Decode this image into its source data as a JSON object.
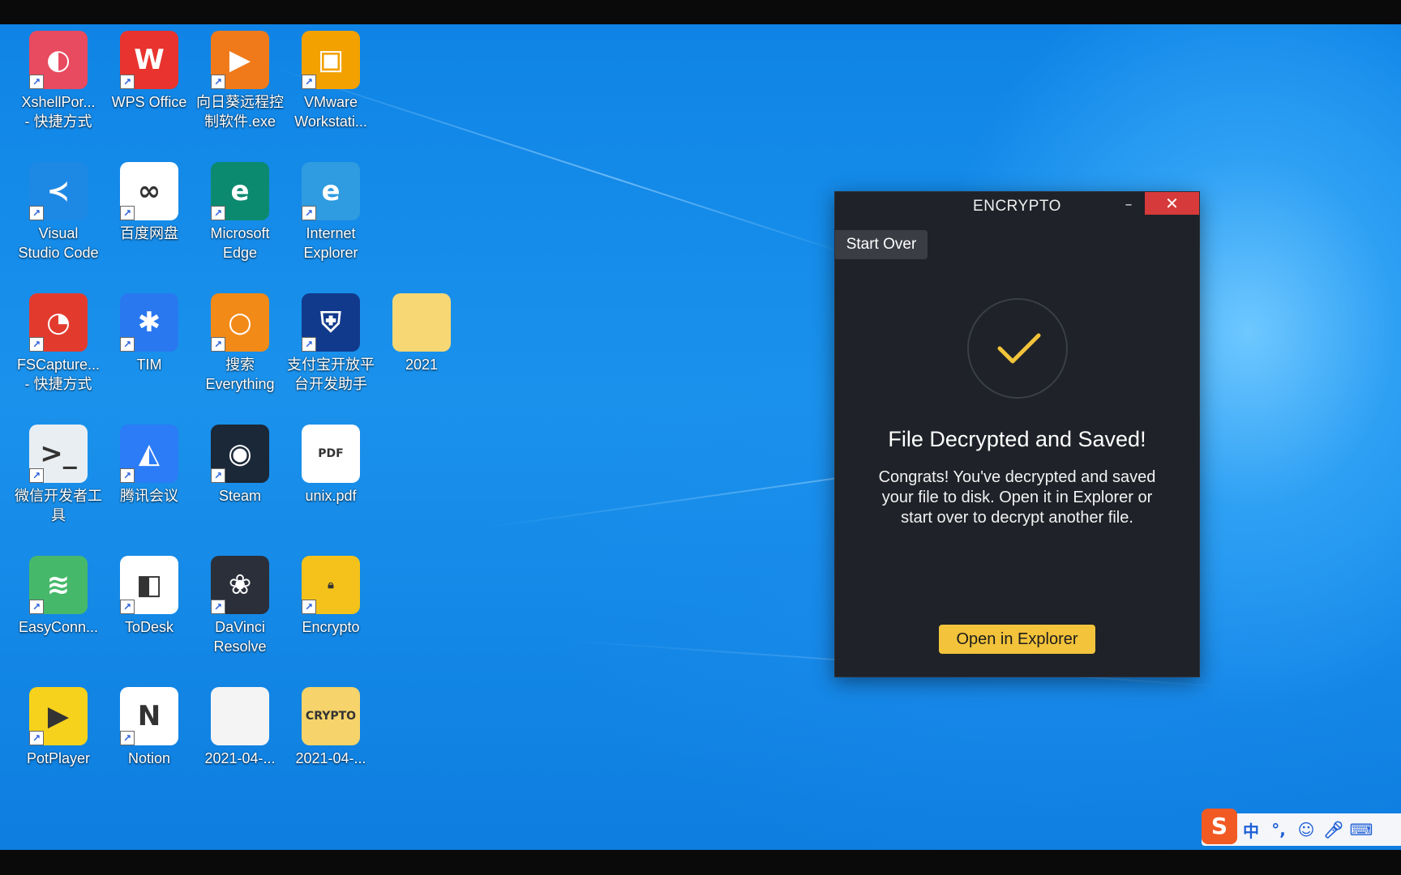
{
  "desktop": {
    "icons": [
      {
        "label": "XshellPor...\n- 快捷方式",
        "glyph": "◐",
        "color": "#e84a5f"
      },
      {
        "label": "WPS Office",
        "glyph": "W",
        "color": "#e8332e"
      },
      {
        "label": "向日葵远程控\n制软件.exe",
        "glyph": "▶",
        "color": "#f07a1a"
      },
      {
        "label": "VMware\nWorkstati...",
        "glyph": "▣",
        "color": "#f2a100"
      },
      {
        "label": "Visual\nStudio Code",
        "glyph": "≺",
        "color": "#1e88e5"
      },
      {
        "label": "百度网盘",
        "glyph": "∞",
        "color": "#ffffff"
      },
      {
        "label": "Microsoft\nEdge",
        "glyph": "e",
        "color": "#0c8a70"
      },
      {
        "label": "Internet\nExplorer",
        "glyph": "e",
        "color": "#2f9be0"
      },
      {
        "label": "FSCapture...\n- 快捷方式",
        "glyph": "◔",
        "color": "#e23b2e"
      },
      {
        "label": "TIM",
        "glyph": "✱",
        "color": "#2a78f0"
      },
      {
        "label": "搜索\nEverything",
        "glyph": "○",
        "color": "#f28a18"
      },
      {
        "label": "支付宝开放平\n台开发助手",
        "glyph": "⛨",
        "color": "#123a8c"
      },
      {
        "label": "2021",
        "glyph": "",
        "color": "#f6d774"
      },
      {
        "label": "微信开发者工\n具",
        "glyph": ">_",
        "color": "#e9eef2"
      },
      {
        "label": "腾讯会议",
        "glyph": "◭",
        "color": "#2b7cf6"
      },
      {
        "label": "Steam",
        "glyph": "◉",
        "color": "#1b2838"
      },
      {
        "label": "unix.pdf",
        "glyph": "PDF",
        "color": "#ffffff"
      },
      {
        "label": "EasyConn...",
        "glyph": "≋",
        "color": "#46b86a"
      },
      {
        "label": "ToDesk",
        "glyph": "◧",
        "color": "#ffffff"
      },
      {
        "label": "DaVinci\nResolve",
        "glyph": "❀",
        "color": "#2a2f3a"
      },
      {
        "label": "Encrypto",
        "glyph": "🔒︎",
        "color": "#f4c21a"
      },
      {
        "label": "PotPlayer",
        "glyph": "▶",
        "color": "#f6d21d"
      },
      {
        "label": "Notion",
        "glyph": "N",
        "color": "#ffffff"
      },
      {
        "label": "2021-04-...",
        "glyph": "",
        "color": "#f4f4f4"
      },
      {
        "label": "2021-04-...",
        "glyph": "CRYPTO",
        "color": "#f6d36b"
      }
    ]
  },
  "window": {
    "title": "ENCRYPTO",
    "minimize_symbol": "–",
    "close_symbol": "✕",
    "start_over": "Start Over",
    "heading": "File Decrypted and Saved!",
    "body": "Congrats! You've decrypted and saved your file to disk. Open it in Explorer or start over to decrypt another file.",
    "open_button": "Open in Explorer",
    "accent": "#f2c33b",
    "close_color": "#d63a3a"
  },
  "ime": {
    "logo": "S",
    "items": [
      "中",
      "°,",
      "☺",
      "🎤︎",
      "⌨"
    ]
  }
}
